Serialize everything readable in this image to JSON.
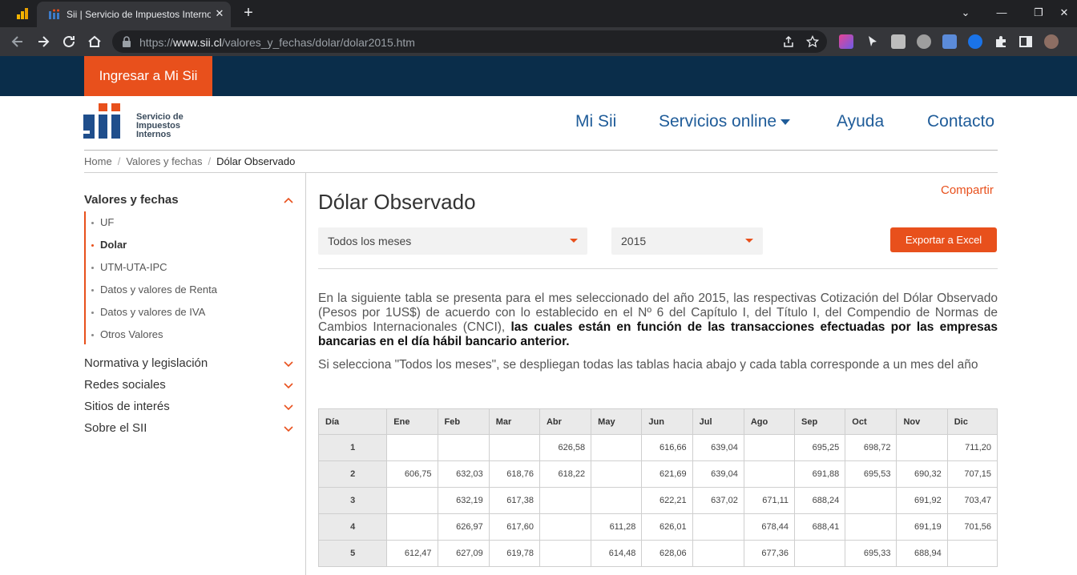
{
  "browser": {
    "tab_title": "Sii | Servicio de Impuestos Internos",
    "url_prefix": "https://",
    "url_host": "www.sii.cl",
    "url_path": "/valores_y_fechas/dolar/dolar2015.htm",
    "tab_close": "✕",
    "new_tab": "+"
  },
  "site": {
    "login_label": "Ingresar a Mi Sii",
    "logo_text": [
      "Servicio de",
      "Impuestos",
      "Internos"
    ],
    "nav": [
      "Mi Sii",
      "Servicios online",
      "Ayuda",
      "Contacto"
    ],
    "breadcrumb": [
      "Home",
      "Valores y fechas",
      "Dólar Observado"
    ],
    "accent_color": "#e8501c",
    "brand_blue": "#1f5c99"
  },
  "sidebar": {
    "section_title": "Valores y fechas",
    "items": [
      "UF",
      "Dolar",
      "UTM-UTA-IPC",
      "Datos y valores de Renta",
      "Datos y valores de IVA",
      "Otros Valores"
    ],
    "active_item": "Dolar",
    "other_sections": [
      "Normativa y legislación",
      "Redes sociales",
      "Sitios de interés",
      "Sobre el SII"
    ]
  },
  "content": {
    "title": "Dólar Observado",
    "share_label": "Compartir",
    "month_select": "Todos los meses",
    "year_select": "2015",
    "export_label": "Exportar a Excel",
    "para1_normal": "En la siguiente tabla se presenta para el mes seleccionado del año 2015, las respectivas Cotización del Dólar Observado (Pesos por 1US$) de acuerdo con lo establecido en el Nº 6 del Capítulo I, del Título I, del Compendio de Normas de Cambios Internacionales (CNCI), ",
    "para1_bold": "las cuales están en función de las transacciones efectuadas por las empresas bancarias en el día hábil bancario anterior.",
    "para2": "Si selecciona \"Todos los meses\", se despliegan todas las tablas hacia abajo y cada tabla corresponde a un mes del año"
  },
  "table": {
    "headers": [
      "Día",
      "Ene",
      "Feb",
      "Mar",
      "Abr",
      "May",
      "Jun",
      "Jul",
      "Ago",
      "Sep",
      "Oct",
      "Nov",
      "Dic"
    ],
    "rows": [
      [
        "1",
        "",
        "",
        "",
        "626,58",
        "",
        "616,66",
        "639,04",
        "",
        "695,25",
        "698,72",
        "",
        "711,20"
      ],
      [
        "2",
        "606,75",
        "632,03",
        "618,76",
        "618,22",
        "",
        "621,69",
        "639,04",
        "",
        "691,88",
        "695,53",
        "690,32",
        "707,15"
      ],
      [
        "3",
        "",
        "632,19",
        "617,38",
        "",
        "",
        "622,21",
        "637,02",
        "671,11",
        "688,24",
        "",
        "691,92",
        "703,47"
      ],
      [
        "4",
        "",
        "626,97",
        "617,60",
        "",
        "611,28",
        "626,01",
        "",
        "678,44",
        "688,41",
        "",
        "691,19",
        "701,56"
      ],
      [
        "5",
        "612,47",
        "627,09",
        "619,78",
        "",
        "614,48",
        "628,06",
        "",
        "677,36",
        "",
        "695,33",
        "688,94",
        ""
      ]
    ]
  }
}
